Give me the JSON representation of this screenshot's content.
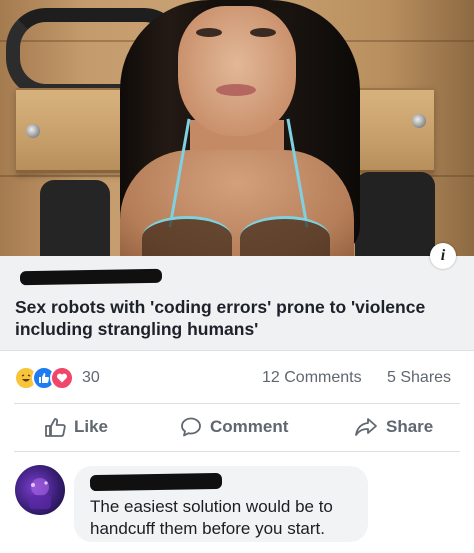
{
  "link_preview": {
    "info_label": "i",
    "headline": "Sex robots with 'coding errors' prone to 'violence including strangling humans'"
  },
  "stats": {
    "reaction_count": "30",
    "comments": "12 Comments",
    "shares": "5 Shares",
    "reactions": [
      "haha",
      "like",
      "love"
    ]
  },
  "actions": {
    "like": "Like",
    "comment": "Comment",
    "share": "Share"
  },
  "comment": {
    "text": "The easiest solution would be to handcuff them before you start."
  },
  "colors": {
    "like_blue": "#1d7cf2",
    "love_red": "#f0466a",
    "haha_yellow": "#f7c43a",
    "secondary_text": "#606770"
  }
}
